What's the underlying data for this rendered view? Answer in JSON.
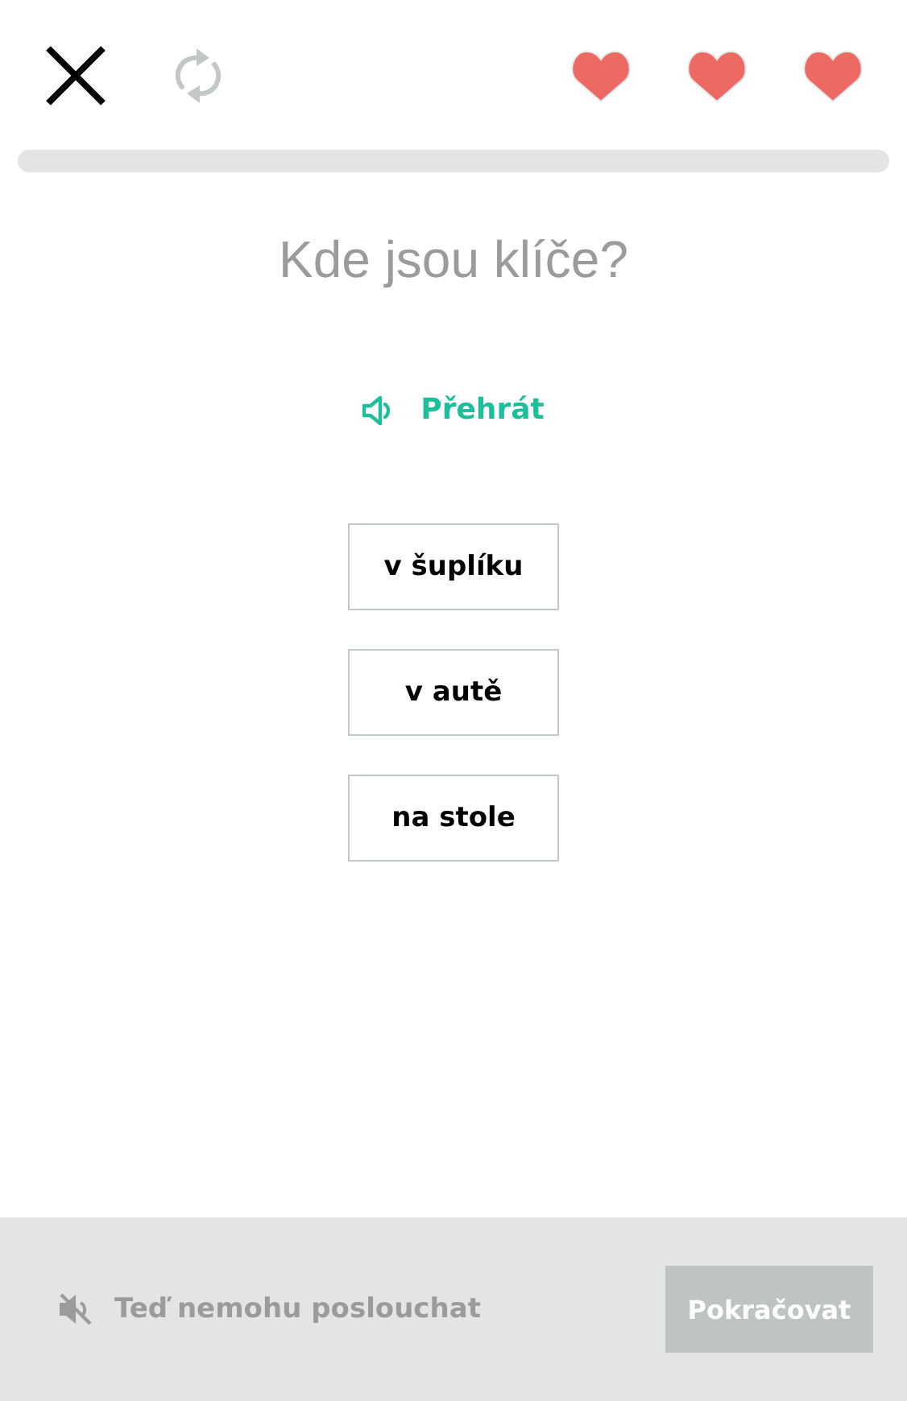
{
  "lives": [
    {
      "filled": true
    },
    {
      "filled": true
    },
    {
      "filled": true
    }
  ],
  "progress": {
    "level": 0
  },
  "question": "Kde jsou klíče?",
  "play_button": {
    "label": "Přehrát"
  },
  "options": [
    {
      "label": "v šuplíku",
      "selected": false
    },
    {
      "label": "v autě",
      "selected": false
    },
    {
      "label": "na stole",
      "selected": false
    }
  ],
  "footer": {
    "cant_listen": "Teď nemohu poslouchat",
    "continue": {
      "label": "Pokračovat",
      "disabled": true
    }
  }
}
